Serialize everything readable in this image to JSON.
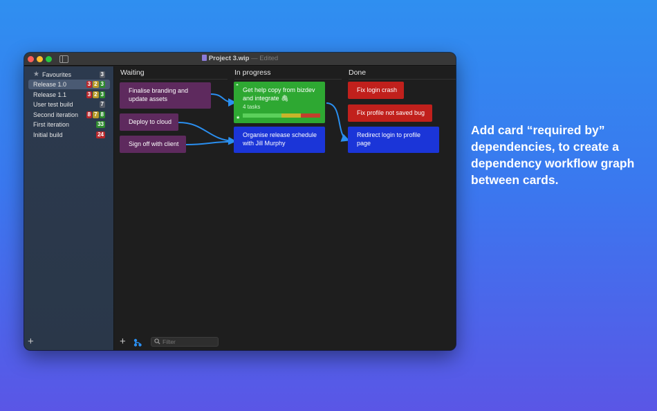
{
  "window": {
    "title": "Project 3.wip",
    "title_separator": " — ",
    "status": "Edited"
  },
  "sidebar": {
    "items": [
      {
        "label": "Favourites",
        "badges": [
          {
            "text": "3",
            "color": "gray"
          }
        ]
      },
      {
        "label": "Release 1.0",
        "selected": true,
        "badges": [
          {
            "text": "3",
            "color": "red"
          },
          {
            "text": "2",
            "color": "yellow"
          },
          {
            "text": "3",
            "color": "green"
          }
        ]
      },
      {
        "label": "Release 1.1",
        "badges": [
          {
            "text": "3",
            "color": "red"
          },
          {
            "text": "2",
            "color": "yellow"
          },
          {
            "text": "3",
            "color": "green"
          }
        ]
      },
      {
        "label": "User test build",
        "badges": [
          {
            "text": "7",
            "color": "gray"
          }
        ]
      },
      {
        "label": "Second iteration",
        "badges": [
          {
            "text": "8",
            "color": "red"
          },
          {
            "text": "7",
            "color": "yellow"
          },
          {
            "text": "8",
            "color": "green"
          }
        ]
      },
      {
        "label": "First iteration",
        "badges": [
          {
            "text": "33",
            "color": "green"
          }
        ]
      },
      {
        "label": "Initial build",
        "badges": [
          {
            "text": "24",
            "color": "red"
          }
        ]
      }
    ]
  },
  "board": {
    "columns": [
      {
        "title": "Waiting"
      },
      {
        "title": "In progress"
      },
      {
        "title": "Done"
      }
    ],
    "cards": {
      "finalise": "Finalise branding and update assets",
      "deploy": "Deploy to cloud",
      "signoff": "Sign off with client",
      "help_copy": "Get help copy from bizdev and integrate 🖇",
      "help_copy_tasks": "4 tasks",
      "help_copy_progress": {
        "done": 0.5,
        "partial": 0.25,
        "blocked": 0.25
      },
      "organise": "Organise release schedule with Jill Murphy",
      "fix_login": "Fix login crash",
      "fix_profile": "Fix profile not saved bug",
      "redirect": "Redirect login to profile page"
    }
  },
  "filter": {
    "placeholder": "Filter"
  },
  "caption": "Add card “required by” dependencies, to create a dependency workflow graph between cards.",
  "colors": {
    "purple": "#5e2a5e",
    "green": "#2ea832",
    "blue": "#1b35d8",
    "red": "#c1201c",
    "link": "#2a8ff0"
  }
}
